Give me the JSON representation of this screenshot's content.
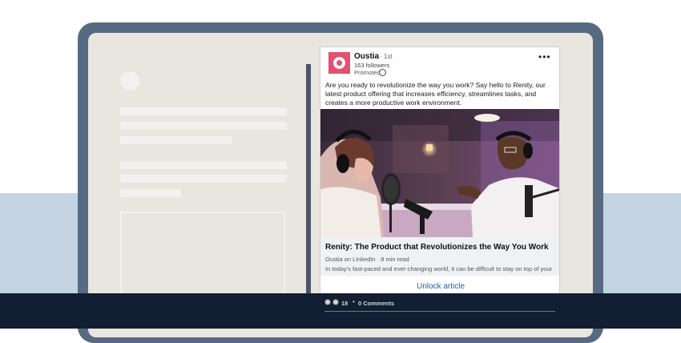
{
  "post": {
    "author": "Oustia",
    "degree": "· 1st",
    "followers": "163 followers",
    "promoted": "Promoted",
    "more": "•••",
    "text": "Are you ready to revolutionize the way you work? Say hello to Renity, our latest product offering that increases efficiency, streamlines tasks, and creates a more productive work environment."
  },
  "article": {
    "title": "Renity: The Product that Revolutionizes the Way You Work",
    "source": "Oustia on LinkedIn · 8 min read",
    "excerpt": "In today's fast-paced and ever-changing world, it can be difficult to stay on top of your",
    "unlock": "Unlock article"
  },
  "reactions": {
    "count": "18",
    "separator": "•",
    "comments": "0 Comments"
  },
  "colors": {
    "brand": "#e4506f",
    "link": "#1f5ea8",
    "laptop_frame": "#566a81",
    "screen": "#e9e5df",
    "band_light": "#c4d4e3",
    "band_dark": "#121e31"
  }
}
